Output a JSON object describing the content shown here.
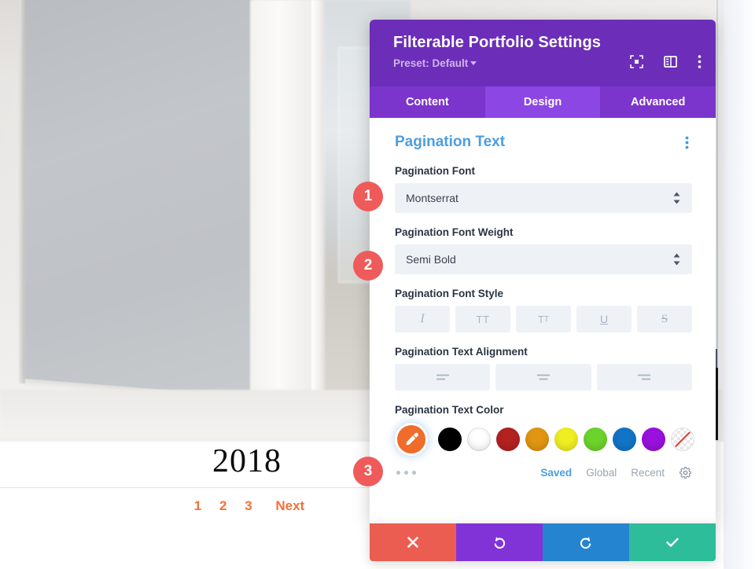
{
  "background": {
    "year_title": "2018",
    "pagination": [
      "1",
      "2",
      "3"
    ],
    "pagination_next": "Next"
  },
  "panel": {
    "title": "Filterable Portfolio Settings",
    "preset_label": "Preset: Default",
    "header_icons": [
      {
        "name": "focus-icon"
      },
      {
        "name": "layout-panel-icon"
      },
      {
        "name": "kebab-menu-icon"
      }
    ],
    "tabs": [
      {
        "label": "Content",
        "active": false
      },
      {
        "label": "Design",
        "active": true
      },
      {
        "label": "Advanced",
        "active": false
      }
    ],
    "section": {
      "title": "Pagination Text",
      "menu_icon": "kebab-menu-icon"
    },
    "fields": {
      "font": {
        "label": "Pagination Font",
        "value": "Montserrat",
        "control": "select"
      },
      "font_weight": {
        "label": "Pagination Font Weight",
        "value": "Semi Bold",
        "control": "select"
      },
      "font_style": {
        "label": "Pagination Font Style",
        "buttons": [
          {
            "name": "italic-button",
            "glyph": "I"
          },
          {
            "name": "uppercase-button",
            "glyph": "TT"
          },
          {
            "name": "small-caps-button",
            "glyph": "T"
          },
          {
            "name": "underline-button",
            "glyph": "U"
          },
          {
            "name": "strikethrough-button",
            "glyph": "S"
          }
        ]
      },
      "text_alignment": {
        "label": "Pagination Text Alignment",
        "buttons": [
          {
            "name": "align-left-button"
          },
          {
            "name": "align-center-button"
          },
          {
            "name": "align-right-button"
          }
        ]
      },
      "text_color": {
        "label": "Pagination Text Color",
        "picker_icon": "eyedropper-icon",
        "picker_color": "#ef6c2a",
        "swatches": [
          {
            "name": "swatch-black",
            "color": "#000000"
          },
          {
            "name": "swatch-white",
            "color": "#ffffff"
          },
          {
            "name": "swatch-dark-red",
            "color": "#b32121"
          },
          {
            "name": "swatch-orange",
            "color": "#e09612"
          },
          {
            "name": "swatch-yellow",
            "color": "#eeee22"
          },
          {
            "name": "swatch-green",
            "color": "#6cd32c"
          },
          {
            "name": "swatch-blue",
            "color": "#1274c6"
          },
          {
            "name": "swatch-purple",
            "color": "#9911dd"
          },
          {
            "name": "swatch-transparent",
            "color": "transparent"
          }
        ],
        "more_icon": "more-dots-icon",
        "tabs": [
          {
            "label": "Saved",
            "active": true
          },
          {
            "label": "Global",
            "active": false
          },
          {
            "label": "Recent",
            "active": false
          }
        ],
        "settings_icon": "gear-icon"
      }
    },
    "footer": [
      {
        "name": "cancel-button",
        "icon": "close-icon",
        "color": "#ec5d51"
      },
      {
        "name": "undo-button",
        "icon": "undo-icon",
        "color": "#8233d8"
      },
      {
        "name": "redo-button",
        "icon": "redo-icon",
        "color": "#2584cf"
      },
      {
        "name": "save-button",
        "icon": "check-icon",
        "color": "#2ebd9a"
      }
    ]
  },
  "callouts": [
    {
      "number": "1"
    },
    {
      "number": "2"
    },
    {
      "number": "3"
    }
  ]
}
